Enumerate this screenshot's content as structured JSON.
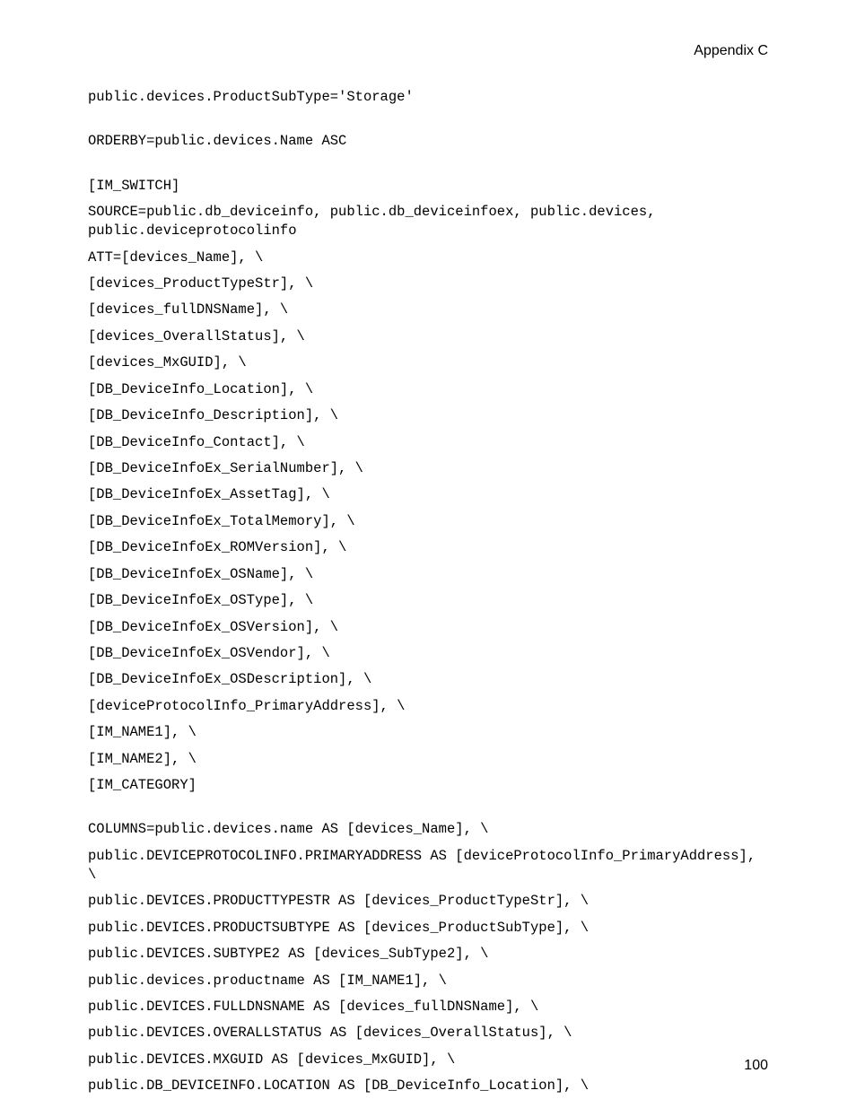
{
  "header": "Appendix C",
  "pageNumber": "100",
  "lines": [
    "public.devices.ProductSubType='Storage'",
    "",
    "ORDERBY=public.devices.Name ASC",
    "",
    "[IM_SWITCH]",
    "SOURCE=public.db_deviceinfo, public.db_deviceinfoex, public.devices, public.deviceprotocolinfo",
    "ATT=[devices_Name], \\",
    "[devices_ProductTypeStr], \\",
    "[devices_fullDNSName], \\",
    "[devices_OverallStatus], \\",
    "[devices_MxGUID], \\",
    "[DB_DeviceInfo_Location], \\",
    "[DB_DeviceInfo_Description], \\",
    "[DB_DeviceInfo_Contact], \\",
    "[DB_DeviceInfoEx_SerialNumber], \\",
    "[DB_DeviceInfoEx_AssetTag], \\",
    "[DB_DeviceInfoEx_TotalMemory], \\",
    "[DB_DeviceInfoEx_ROMVersion], \\",
    "[DB_DeviceInfoEx_OSName], \\",
    "[DB_DeviceInfoEx_OSType], \\",
    "[DB_DeviceInfoEx_OSVersion], \\",
    "[DB_DeviceInfoEx_OSVendor], \\",
    "[DB_DeviceInfoEx_OSDescription], \\",
    "[deviceProtocolInfo_PrimaryAddress], \\",
    "[IM_NAME1], \\",
    "[IM_NAME2], \\",
    "[IM_CATEGORY]",
    "",
    "COLUMNS=public.devices.name AS [devices_Name], \\",
    "public.DEVICEPROTOCOLINFO.PRIMARYADDRESS AS [deviceProtocolInfo_PrimaryAddress], \\",
    "public.DEVICES.PRODUCTTYPESTR AS [devices_ProductTypeStr], \\",
    "public.DEVICES.PRODUCTSUBTYPE AS [devices_ProductSubType], \\",
    "public.DEVICES.SUBTYPE2 AS [devices_SubType2], \\",
    "public.devices.productname AS [IM_NAME1], \\",
    "public.DEVICES.FULLDNSNAME AS [devices_fullDNSName], \\",
    "public.DEVICES.OVERALLSTATUS AS [devices_OverallStatus], \\",
    "public.DEVICES.MXGUID AS [devices_MxGUID], \\",
    "public.DB_DEVICEINFO.LOCATION AS [DB_DeviceInfo_Location], \\"
  ]
}
